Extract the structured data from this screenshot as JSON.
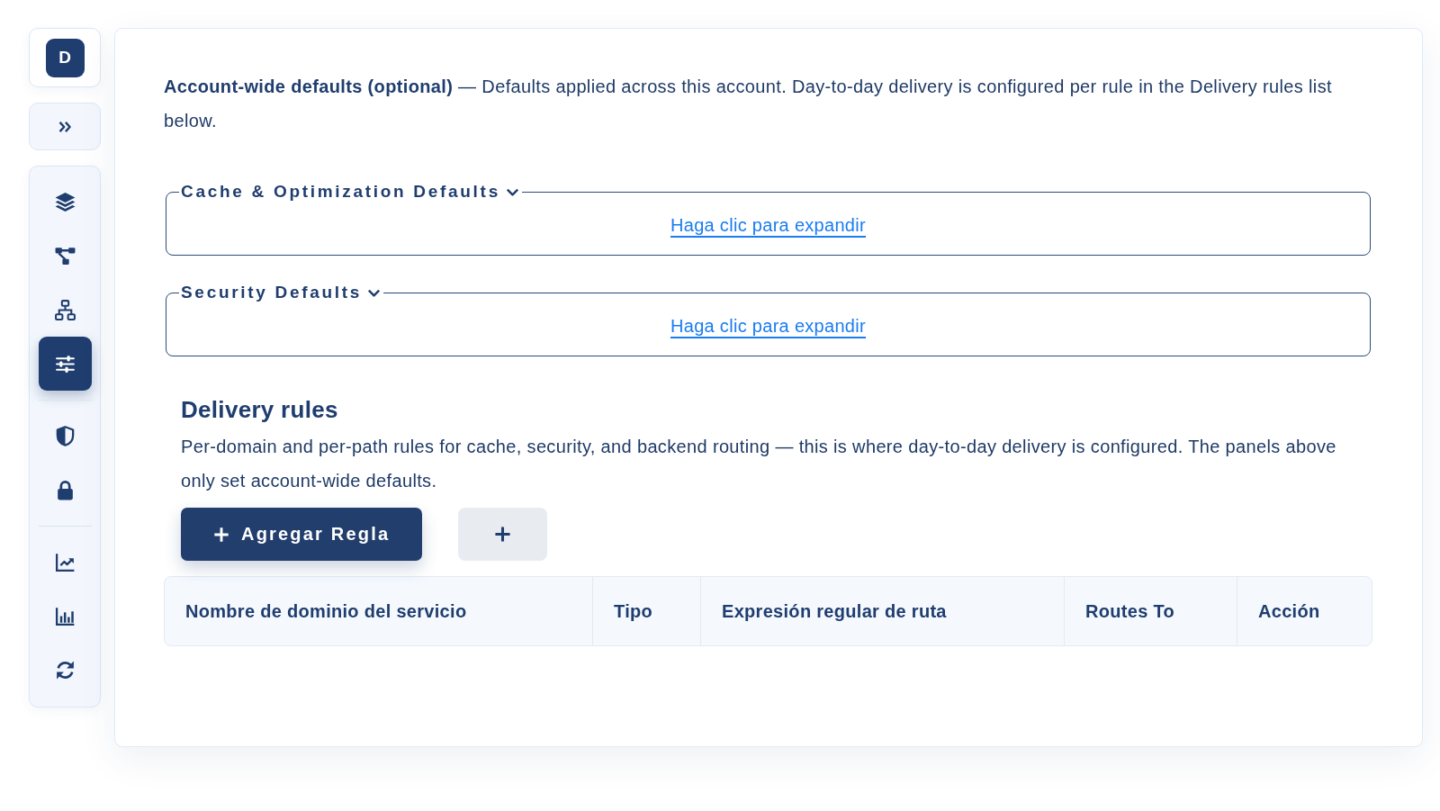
{
  "sidebar": {
    "logo": "D",
    "groups": [
      {
        "items": [
          {
            "selected": false
          },
          {
            "selected": false
          },
          {
            "selected": false
          },
          {
            "selected": true
          }
        ]
      },
      {
        "items": [
          {
            "selected": false
          },
          {
            "selected": false
          }
        ]
      },
      {
        "items": [
          {
            "selected": false
          },
          {
            "selected": false
          },
          {
            "selected": false
          }
        ]
      }
    ]
  },
  "intro": "**Account-wide defaults (optional)** — Defaults applied across this account. Day-to-day delivery is configured per rule in the Delivery rules list below.",
  "panels": [
    {
      "title": "Cache & Optimization Defaults",
      "expanded": false,
      "link": "Haga clic para expandir"
    },
    {
      "title": "Security Defaults",
      "expanded": false,
      "link": "Haga clic para expandir"
    }
  ],
  "delivery_rules": {
    "title": "Delivery rules",
    "description": "Per-domain and per-path rules for cache, security, and backend routing — this is where day-to-day delivery is configured. The panels above only set account-wide defaults.",
    "add_button": "Agregar Regla",
    "table": {
      "columns": [
        "Nombre de dominio del servicio",
        "Tipo",
        "Expresión regular de ruta",
        "Routes To",
        "Acción"
      ]
    }
  }
}
